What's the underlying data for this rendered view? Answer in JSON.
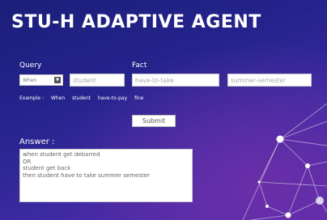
{
  "app": {
    "title": "STU-H ADAPTIVE AGENT"
  },
  "query": {
    "label": "Query",
    "select_value": "When",
    "input_value": "student"
  },
  "fact": {
    "label": "Fact",
    "input1_value": "have-to-take",
    "input2_value": "summer-semester"
  },
  "example": {
    "prefix": "Example :",
    "words": [
      "When",
      "student",
      "have-to-pay",
      "fine"
    ]
  },
  "submit_label": "Submit",
  "answer": {
    "label": "Answer :",
    "lines": [
      "when student get debarred",
      "OR",
      "student get back",
      "then student have to take summer semester"
    ]
  },
  "colors": {
    "background_top": "#1b1f7a",
    "background_bottom": "#5a2bb0",
    "text": "#ffffff"
  },
  "icons": {
    "select_arrow": "chevron-down-icon"
  }
}
